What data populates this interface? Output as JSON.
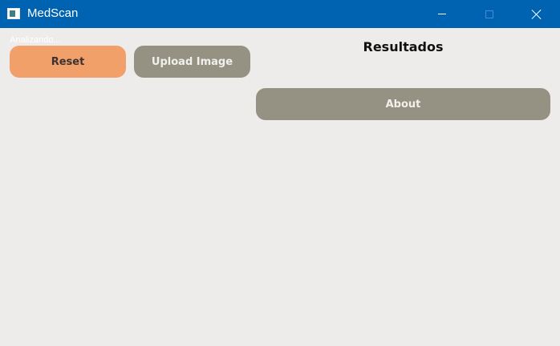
{
  "window": {
    "title": "MedScan",
    "icon": "app-icon",
    "titlebar_color": "#0063b1",
    "controls": {
      "minimize_icon": "minimize-icon",
      "maximize_icon": "maximize-icon",
      "close_icon": "close-icon"
    }
  },
  "status": {
    "text": "Analizando..."
  },
  "buttons": {
    "reset_label": "Reset",
    "upload_label": "Upload Image",
    "about_label": "About"
  },
  "results": {
    "title": "Resultados"
  },
  "colors": {
    "reset_bg": "#f2a06a",
    "neutral_button_bg": "#959283",
    "background": "#eeecea"
  }
}
